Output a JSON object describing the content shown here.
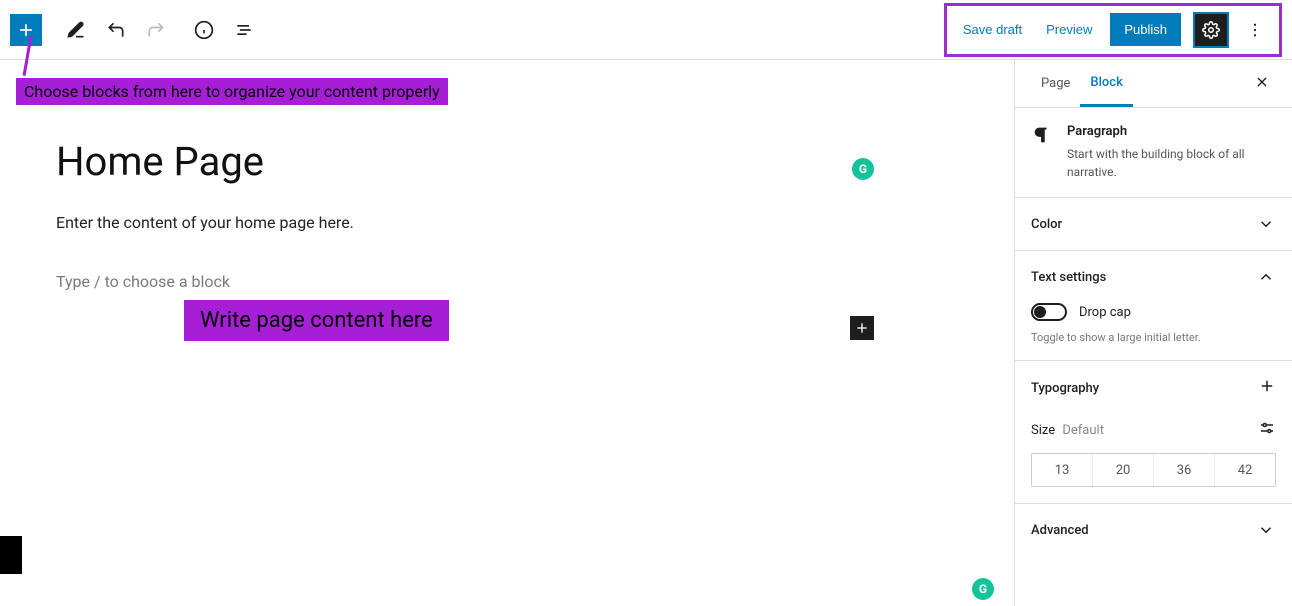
{
  "toolbar": {
    "save_draft": "Save draft",
    "preview": "Preview",
    "publish": "Publish"
  },
  "annotations": {
    "choose_blocks": "Choose blocks from here to organize your content properly",
    "write_content": "Write page content here"
  },
  "editor": {
    "title": "Home Page",
    "body_text": "Enter the content of your home page here.",
    "block_placeholder": "Type / to choose a block"
  },
  "sidebar": {
    "tabs": {
      "page": "Page",
      "block": "Block"
    },
    "block_info": {
      "title": "Paragraph",
      "desc": "Start with the building block of all narrative."
    },
    "panels": {
      "color": "Color",
      "text_settings": "Text settings",
      "typography": "Typography",
      "advanced": "Advanced"
    },
    "text_settings": {
      "drop_cap_label": "Drop cap",
      "drop_cap_help": "Toggle to show a large initial letter."
    },
    "typography": {
      "size_label": "Size",
      "size_default": "Default",
      "presets": [
        "13",
        "20",
        "36",
        "42"
      ]
    }
  },
  "icons": {
    "grammarly": "G"
  }
}
